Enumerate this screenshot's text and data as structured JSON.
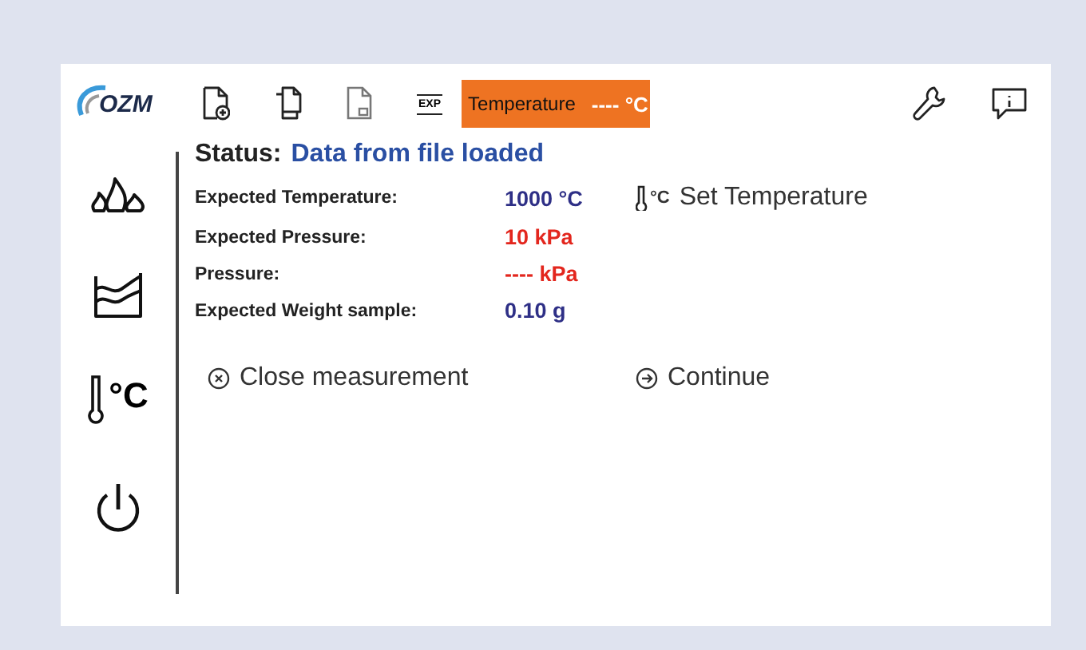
{
  "logo": {
    "text": "OZM"
  },
  "toolbar": [
    {
      "kind": "new-file"
    },
    {
      "kind": "copy"
    },
    {
      "kind": "file-lock"
    },
    {
      "kind": "export",
      "label": "EXP"
    }
  ],
  "temperature_display": {
    "label": "Temperature",
    "value": "---- °C"
  },
  "toolbar_right": [
    {
      "kind": "settings"
    },
    {
      "kind": "info"
    }
  ],
  "sidebar": {
    "items": [
      {
        "kind": "flames"
      },
      {
        "kind": "chart"
      },
      {
        "kind": "thermometer",
        "label": "°C"
      },
      {
        "kind": "power"
      }
    ]
  },
  "status": {
    "label": "Status:",
    "value": "Data from file loaded"
  },
  "readings": [
    {
      "label": "Expected Temperature:",
      "value": "1000 °C",
      "color": "#2e2f86"
    },
    {
      "label": "Expected Pressure:",
      "value": "10 kPa",
      "color": "#e3261d"
    },
    {
      "label": "Pressure:",
      "value": "---- kPa",
      "color": "#e3261d"
    },
    {
      "label": "Expected Weight sample:",
      "value": "0.10 g",
      "color": "#2e2f86"
    }
  ],
  "set_temperature": {
    "icon_label": "°C",
    "label": "Set Temperature"
  },
  "actions": [
    {
      "kind": "close",
      "label": "Close measurement"
    },
    {
      "kind": "continue",
      "label": "Continue"
    }
  ]
}
